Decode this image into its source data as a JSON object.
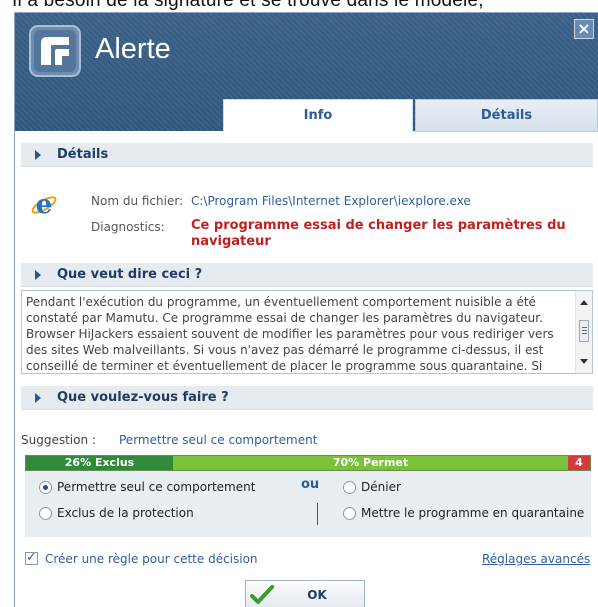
{
  "background_text": "Il a besoin de la signature et se trouve dans le modèle,",
  "window": {
    "title": "Alerte",
    "close_glyph": "×",
    "accent_color": "#325a80"
  },
  "tabs": [
    {
      "label": "Info",
      "active": true
    },
    {
      "label": "Détails",
      "active": false
    }
  ],
  "sections": {
    "details": "Détails",
    "meaning": "Que veut dire ceci ?",
    "action": "Que voulez-vous faire ?"
  },
  "details": {
    "file_label": "Nom du fichier:",
    "file_value": "C:\\Program Files\\Internet Explorer\\iexplore.exe",
    "diag_label": "Diagnostics:",
    "diag_value": "Ce programme essai de changer les paramètres du navigateur",
    "icon": "internet-explorer-icon"
  },
  "description": "Pendant l'exécution du programme, un éventuellement comportement nuisible a été constaté par Mamutu. Ce programme essai de changer les paramètres du navigateur. Browser HiJackers essaient souvent de modifier les paramètres pour vous rediriger vers des sites Web malveillants. Si vous n'avez pas démarré le programme ci-dessus, il est conseillé de terminer et éventuellement de placer le programme sous quarantaine. Si vous",
  "suggestion": {
    "label": "Suggestion :",
    "value": "Permettre seul ce comportement"
  },
  "vote_bar": {
    "segments": [
      {
        "label": "26% Exclus",
        "percent": 26,
        "color": "#2f8a3a"
      },
      {
        "label": "70% Permet",
        "percent": 70,
        "color": "#79c23a"
      },
      {
        "label": "4",
        "percent": 4,
        "color": "#d73a3a"
      }
    ]
  },
  "options": {
    "allow": "Permettre seul ce comportement",
    "exclude": "Exclus de la protection",
    "or": "ou",
    "deny": "Dénier",
    "quarantine": "Mettre le programme en quarantaine",
    "selected": "allow"
  },
  "footer": {
    "rule_checkbox": "Créer une règle pour cette décision",
    "rule_checked": true,
    "advanced_link": "Réglages avancés",
    "ok": "OK"
  }
}
